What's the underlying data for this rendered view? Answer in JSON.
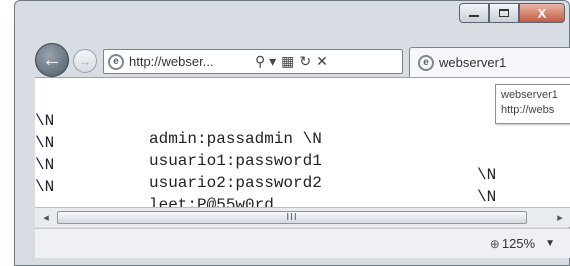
{
  "window": {
    "caption": {
      "minimize": "",
      "maximize": "",
      "close": "X"
    }
  },
  "nav": {
    "back_icon": "arrow-left",
    "forward_icon": "arrow-right",
    "back_glyph": "←",
    "forward_glyph": "→",
    "ie_glyph": "e"
  },
  "address": {
    "url": "http://webser...",
    "search_glyph": "⚲ ▾",
    "compat_glyph": "▦",
    "refresh_glyph": "↻",
    "stop_glyph": "✕"
  },
  "tab": {
    "label": "webserver1"
  },
  "tooltip": {
    "title": "webserver1",
    "url": "http://webs"
  },
  "content": {
    "rows": [
      {
        "c1": "\\N",
        "c2": "admin:passadmin \\N",
        "c3": "",
        "c4": "\\N"
      },
      {
        "c1": "\\N",
        "c2": "usuario1:password1",
        "c3": "",
        "c4": "\\N"
      },
      {
        "c1": "\\N",
        "c2": "usuario2:password2",
        "c3": "",
        "c4": "\\N"
      },
      {
        "c1": "\\N",
        "c2": "leet:P@55w0rd",
        "c3": "\\N",
        "c4": "\\N"
      }
    ]
  },
  "scrollbar": {
    "thumb_grip": "III",
    "left_glyph": "◂",
    "right_glyph": "▸"
  },
  "status": {
    "zoom": "125%",
    "zoom_glyph": "⊕",
    "zoom_arrow": "▼"
  },
  "colors": {
    "close_button": "#c45a40",
    "chrome": "#d8dde3"
  }
}
